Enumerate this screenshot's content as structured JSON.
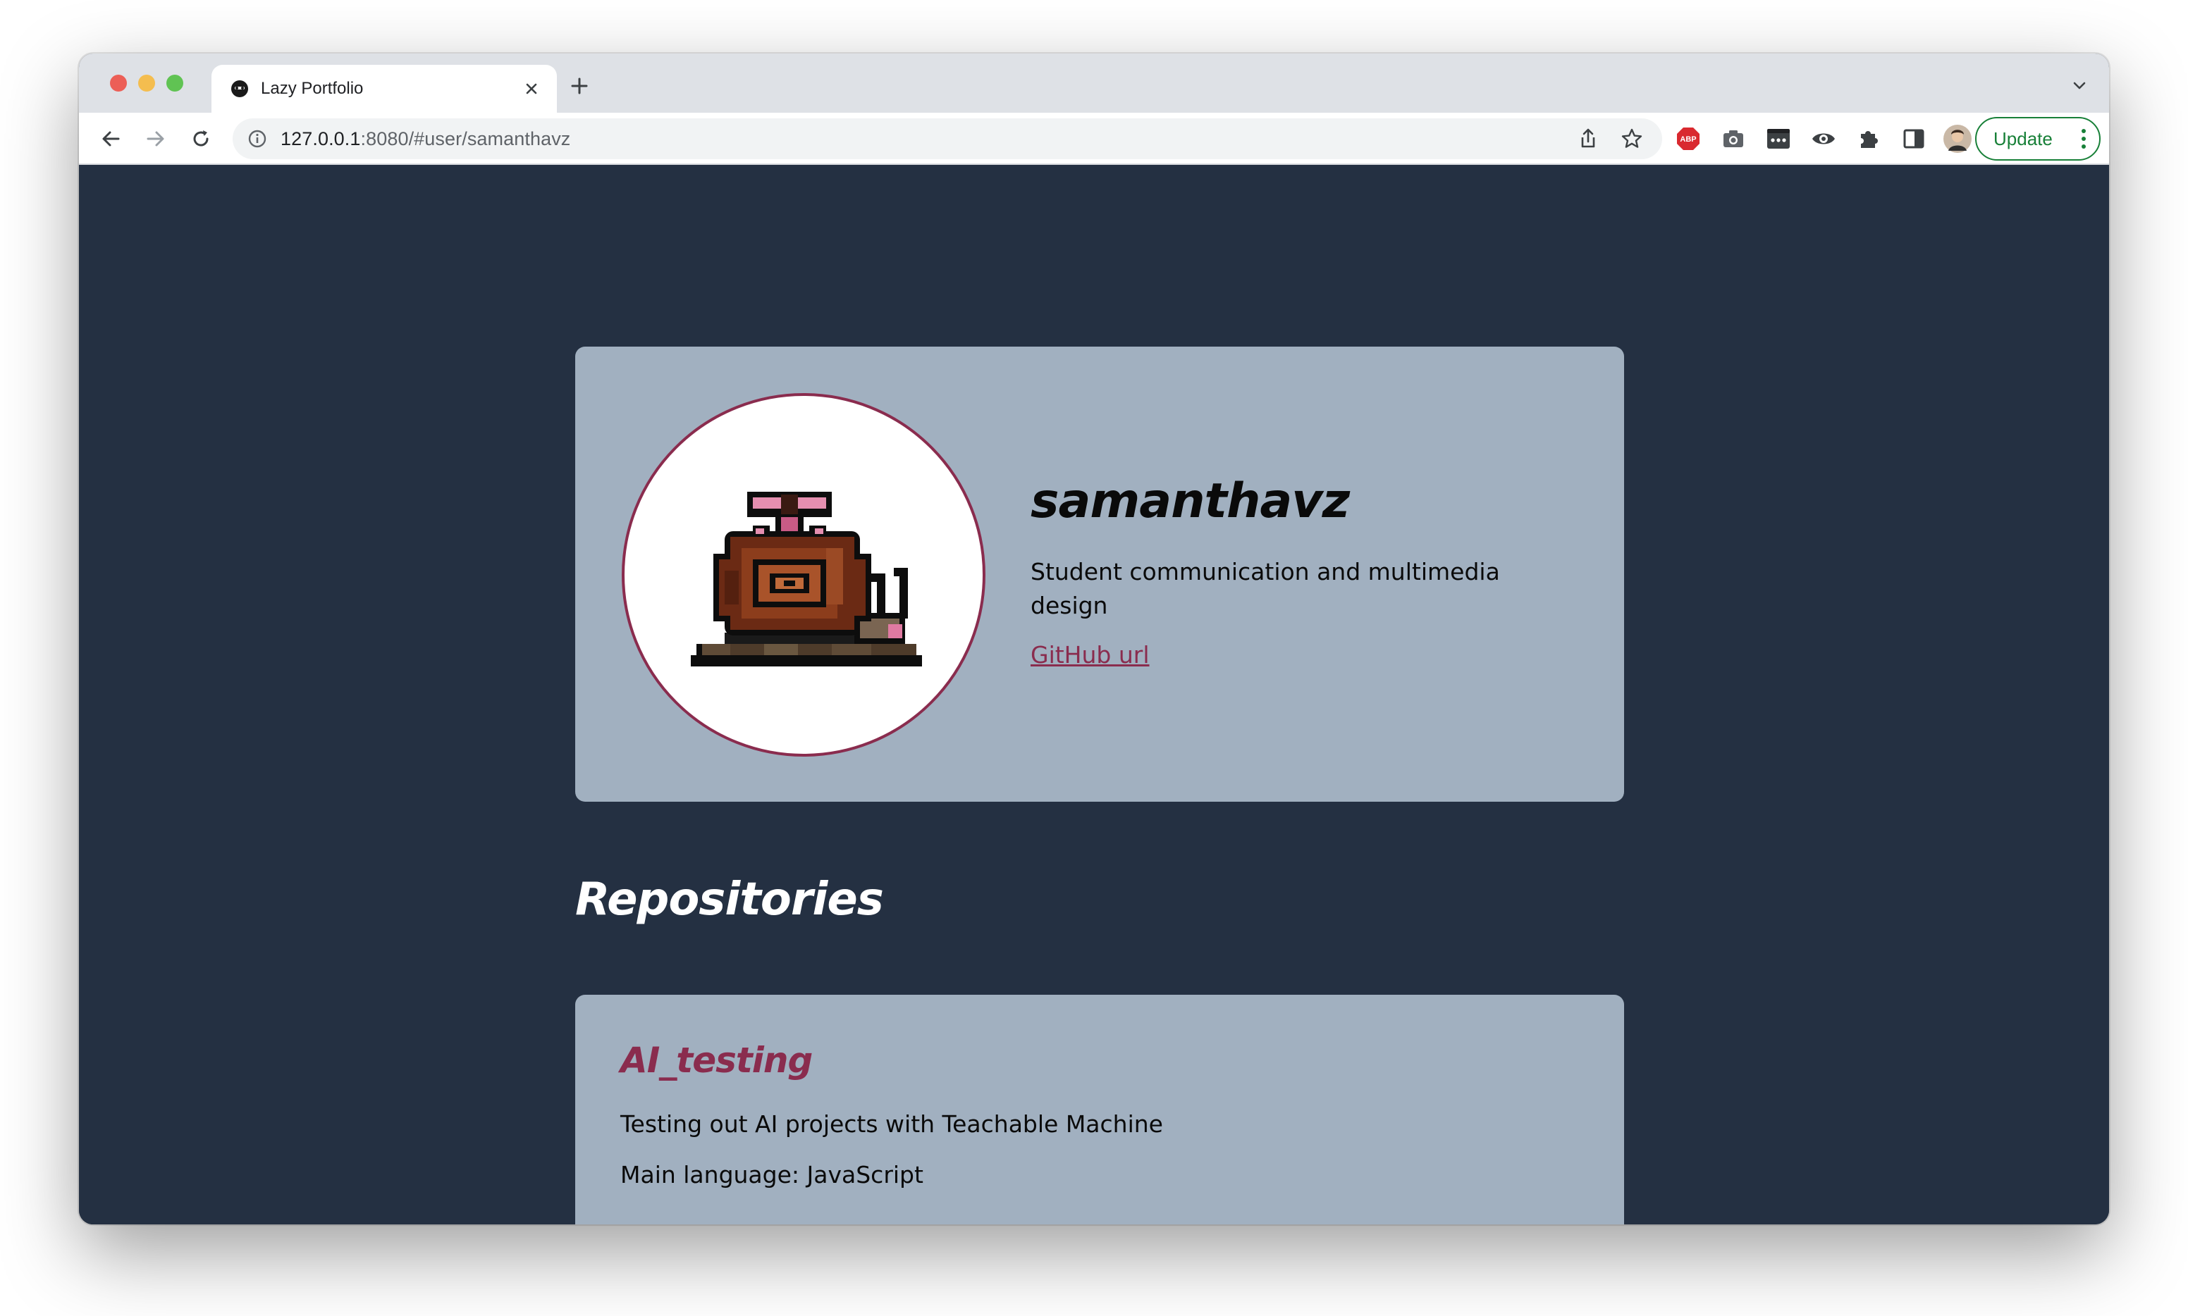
{
  "browser": {
    "tab_title": "Lazy Portfolio",
    "url_host": "127.0.0.1",
    "url_rest": ":8080/#user/samanthavz",
    "update_label": "Update",
    "toolbar_icons": [
      "back-icon",
      "forward-icon",
      "reload-icon",
      "info-icon",
      "share-icon",
      "star-icon",
      "adblock-icon",
      "camera-icon",
      "password-icon",
      "eye-icon",
      "puzzle-icon",
      "sidepanel-icon",
      "profile-avatar"
    ]
  },
  "profile": {
    "username": "samanthavz",
    "bio": "Student communication and multimedia design",
    "github_link_label": "GitHub url",
    "avatar_icon": "snail-pixel-art"
  },
  "repositories": {
    "heading": "Repositories",
    "items": [
      {
        "name": "AI_testing",
        "description": "Testing out AI projects with Teachable Machine",
        "language_label": "Main language: JavaScript"
      }
    ]
  },
  "colors": {
    "page_bg": "#243042",
    "card_bg": "#a1b0c0",
    "accent": "#8a2c4e",
    "update_green": "#188038"
  }
}
